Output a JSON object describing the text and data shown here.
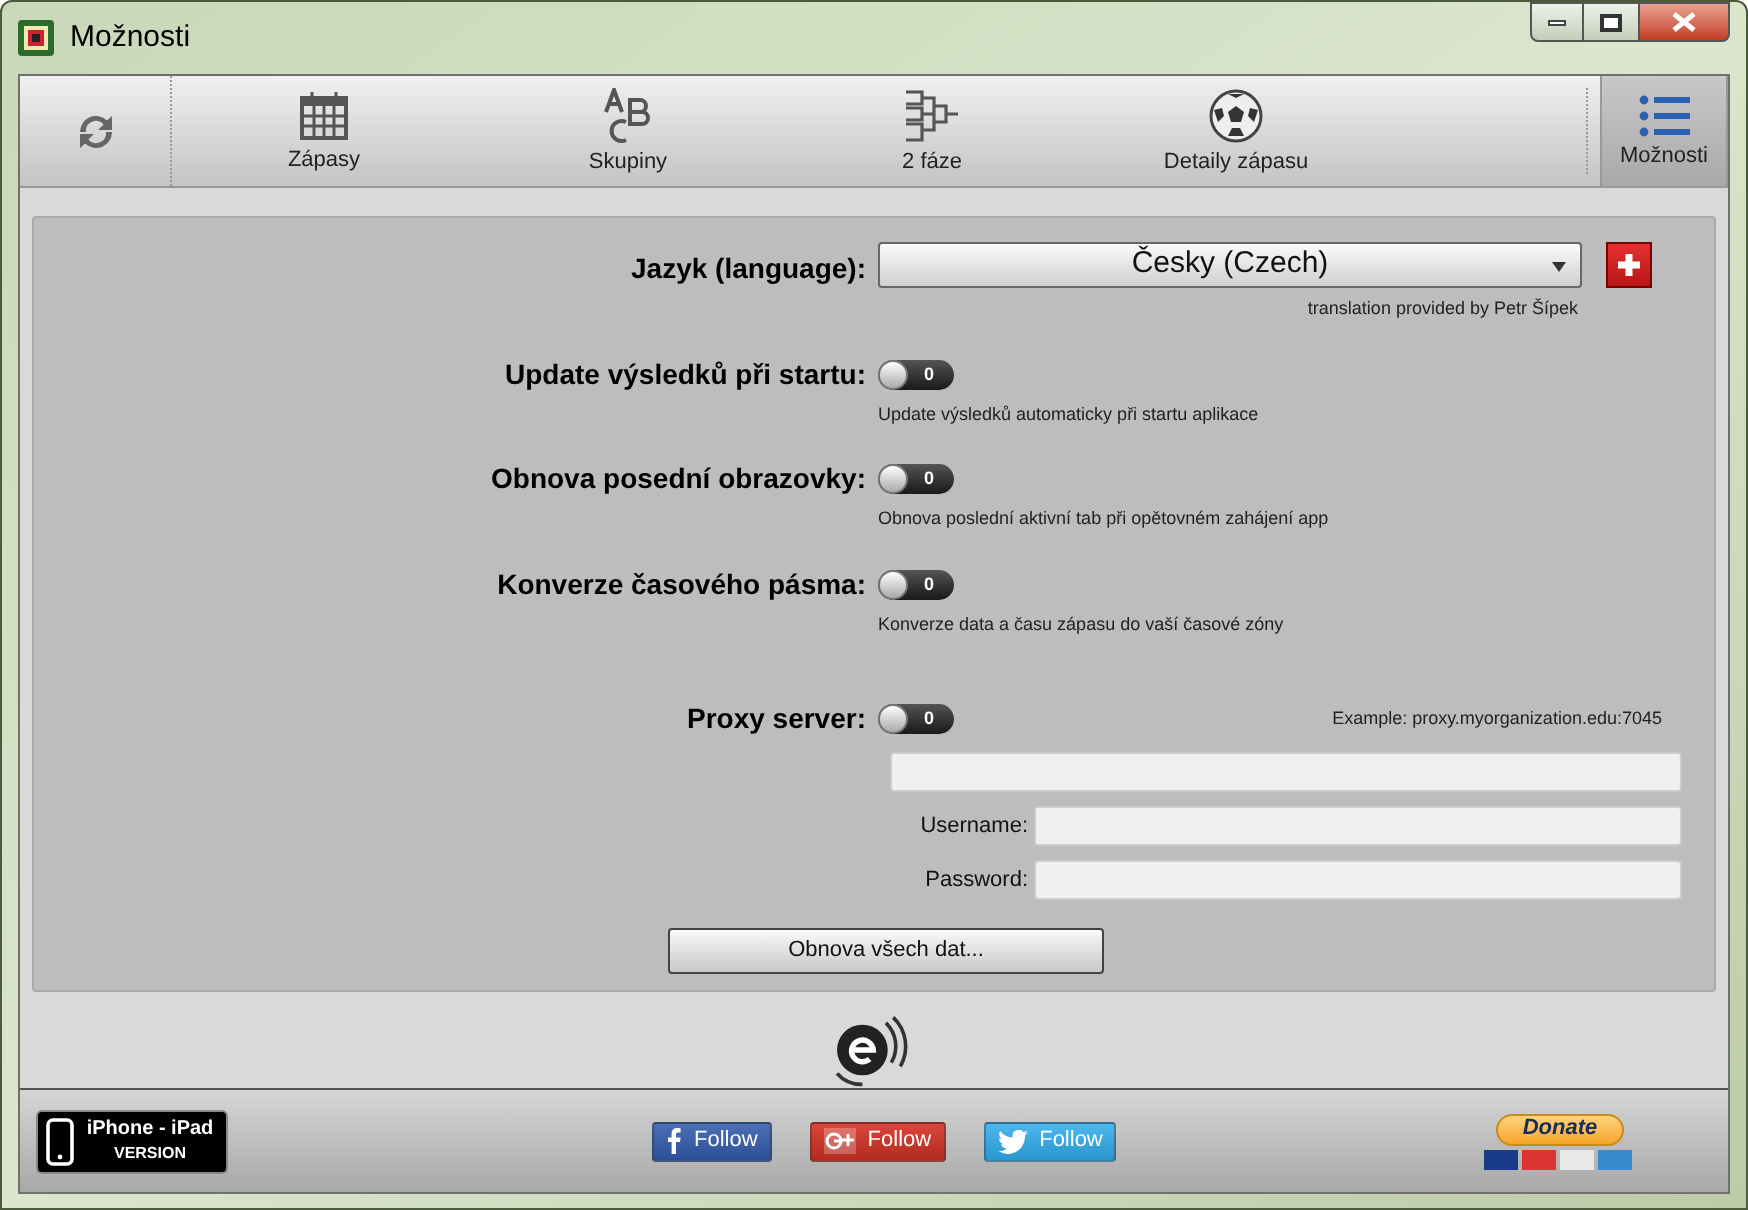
{
  "window": {
    "title": "Možnosti"
  },
  "toolbar": {
    "items": [
      {
        "kind": "refresh",
        "selected": false
      },
      {
        "kind": "calendar",
        "label": "Zápasy",
        "selected": false
      },
      {
        "kind": "abc",
        "label": "Skupiny",
        "selected": false
      },
      {
        "kind": "bracket",
        "label": "2 fáze",
        "selected": false
      },
      {
        "kind": "ball",
        "label": "Detaily zápasu",
        "selected": false
      },
      {
        "kind": "list",
        "label": "Možnosti",
        "selected": true
      }
    ]
  },
  "language": {
    "label": "Jazyk (language):",
    "value": "Česky (Czech)",
    "note": "translation provided by Petr Šípek"
  },
  "settings": [
    {
      "label": "Update výsledků při startu:",
      "toggle": {
        "on": false,
        "text": "0"
      },
      "caption": "Update výsledků automaticky při startu aplikace"
    },
    {
      "label": "Obnova posední obrazovky:",
      "toggle": {
        "on": false,
        "text": "0"
      },
      "caption": "Obnova poslední aktivní tab při opětovném zahájení app"
    },
    {
      "label": "Konverze časového pásma:",
      "toggle": {
        "on": false,
        "text": "0"
      },
      "caption": "Konverze data a času zápasu do vaší časové zóny"
    }
  ],
  "proxy": {
    "label": "Proxy server:",
    "toggle": {
      "on": false,
      "text": "0"
    },
    "example": "Example: proxy.myorganization.edu:7045",
    "fields": [
      {
        "label": "Username:"
      },
      {
        "label": "Password:"
      }
    ]
  },
  "refresh_all_button": "Obnova všech dat...",
  "footer": {
    "app_badge": {
      "title": "iPhone - iPad",
      "subtitle": "VERSION"
    },
    "follow_buttons": [
      {
        "kind": "facebook",
        "label": "Follow"
      },
      {
        "kind": "googleplus",
        "label": "Follow"
      },
      {
        "kind": "twitter",
        "label": "Follow"
      }
    ],
    "donate": "Donate"
  }
}
